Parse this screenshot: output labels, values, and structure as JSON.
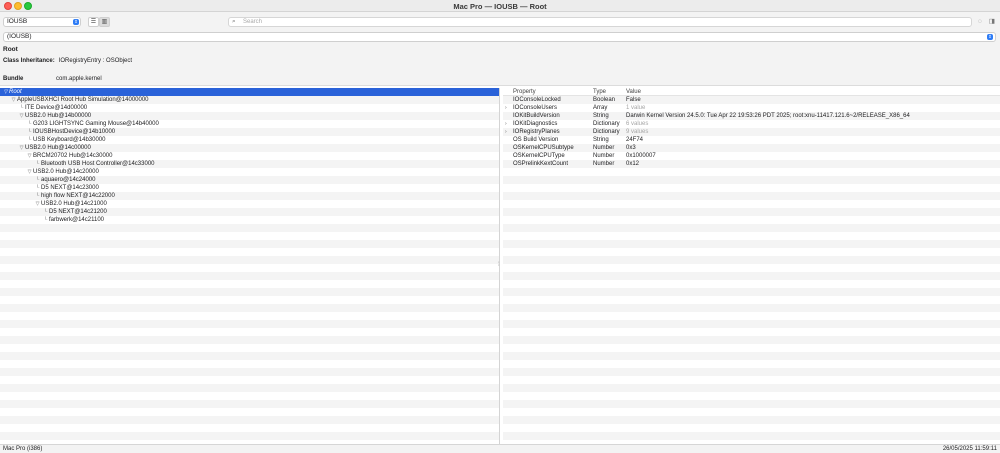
{
  "window": {
    "title": "Mac Pro — IOUSB — Root"
  },
  "toolbar": {
    "plane": "IOUSB",
    "search_placeholder": "Search",
    "path": "(IOUSB)"
  },
  "info": {
    "title": "Root",
    "class_label": "Class Inheritance:",
    "class_value": "IORegistryEntry : OSObject",
    "bundle_label": "Bundle",
    "bundle_value": "com.apple.kernel"
  },
  "tree": [
    {
      "label": "Root",
      "depth": 0,
      "disclosure": "open",
      "selected": true
    },
    {
      "label": "AppleUSBXHCI Root Hub Simulation@14000000",
      "depth": 1,
      "disclosure": "open"
    },
    {
      "label": "ITE Device@14d00000",
      "depth": 2,
      "disclosure": "none"
    },
    {
      "label": "USB2.0 Hub@14b00000",
      "depth": 2,
      "disclosure": "open"
    },
    {
      "label": "G203 LIGHTSYNC Gaming Mouse@14b40000",
      "depth": 3,
      "disclosure": "none"
    },
    {
      "label": "IOUSBHostDevice@14b10000",
      "depth": 3,
      "disclosure": "none"
    },
    {
      "label": "USB Keyboard@14b30000",
      "depth": 3,
      "disclosure": "none"
    },
    {
      "label": "USB2.0 Hub@14c00000",
      "depth": 2,
      "disclosure": "open"
    },
    {
      "label": "BRCM20702 Hub@14c30000",
      "depth": 3,
      "disclosure": "open"
    },
    {
      "label": "Bluetooth USB Host Controller@14c33000",
      "depth": 4,
      "disclosure": "none"
    },
    {
      "label": "USB2.0 Hub@14c20000",
      "depth": 3,
      "disclosure": "open"
    },
    {
      "label": "aquaero@14c24000",
      "depth": 4,
      "disclosure": "none"
    },
    {
      "label": "D5 NEXT@14c23000",
      "depth": 4,
      "disclosure": "none"
    },
    {
      "label": "high flow NEXT@14c22000",
      "depth": 4,
      "disclosure": "none"
    },
    {
      "label": "USB2.0 Hub@14c21000",
      "depth": 4,
      "disclosure": "open"
    },
    {
      "label": "D5 NEXT@14c21200",
      "depth": 5,
      "disclosure": "none"
    },
    {
      "label": "farbwerk@14c21100",
      "depth": 5,
      "disclosure": "none"
    }
  ],
  "properties": {
    "headers": {
      "property": "Property",
      "type": "Type",
      "value": "Value"
    },
    "rows": [
      {
        "property": "IOConsoleLocked",
        "type": "Boolean",
        "value": "False",
        "expandable": false,
        "dim": false
      },
      {
        "property": "IOConsoleUsers",
        "type": "Array",
        "value": "1 value",
        "expandable": true,
        "dim": true
      },
      {
        "property": "IOKitBuildVersion",
        "type": "String",
        "value": "Darwin Kernel Version 24.5.0: Tue Apr 22 19:53:26 PDT 2025; root:xnu-11417.121.6~2/RELEASE_X86_64",
        "expandable": false,
        "dim": false
      },
      {
        "property": "IOKitDiagnostics",
        "type": "Dictionary",
        "value": "6 values",
        "expandable": true,
        "dim": true
      },
      {
        "property": "IORegistryPlanes",
        "type": "Dictionary",
        "value": "9 values",
        "expandable": true,
        "dim": true
      },
      {
        "property": "OS Build Version",
        "type": "String",
        "value": "24F74",
        "expandable": false,
        "dim": false
      },
      {
        "property": "OSKernelCPUSubtype",
        "type": "Number",
        "value": "0x3",
        "expandable": false,
        "dim": false
      },
      {
        "property": "OSKernelCPUType",
        "type": "Number",
        "value": "0x1000007",
        "expandable": false,
        "dim": false
      },
      {
        "property": "OSPrelinkKextCount",
        "type": "Number",
        "value": "0x12",
        "expandable": false,
        "dim": false
      }
    ]
  },
  "status": {
    "left": "Mac Pro (i386)",
    "right": "26/05/2025 11:59:11"
  }
}
